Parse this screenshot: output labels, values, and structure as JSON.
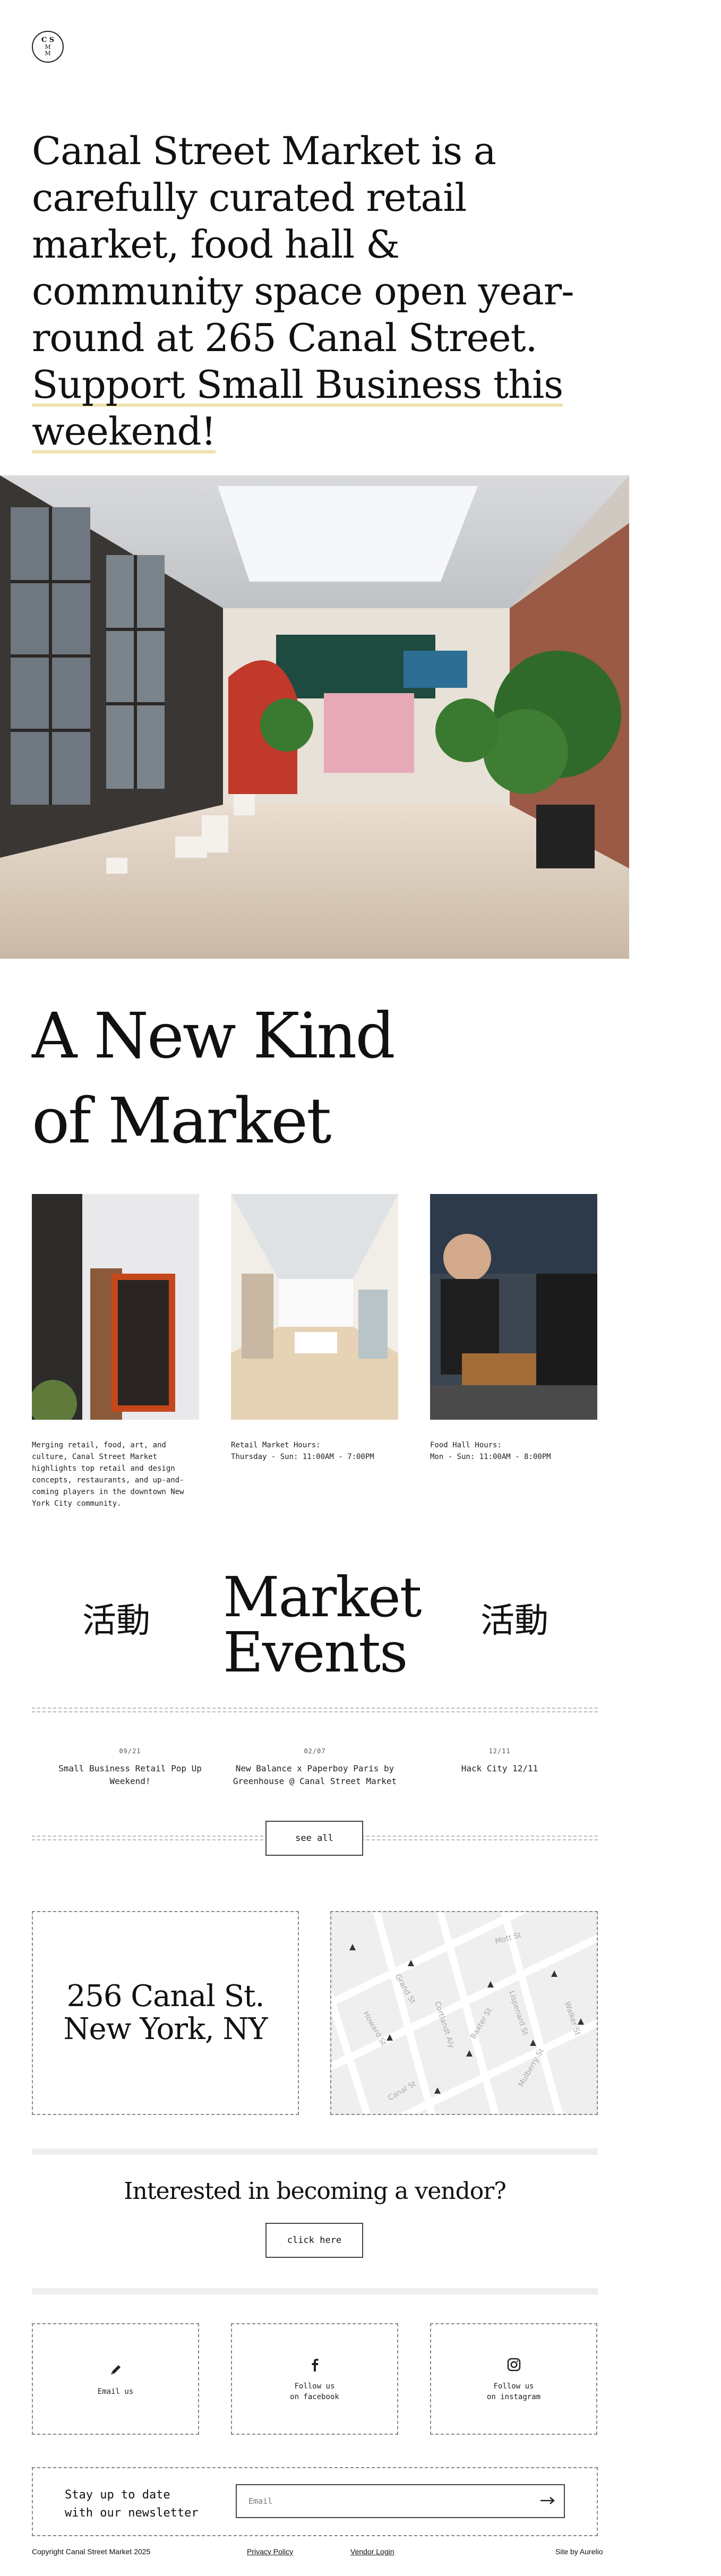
{
  "logo": {
    "line1": "C S",
    "line2": "M",
    "line3": "M"
  },
  "hero": {
    "text_main": "Canal Street Market is a carefully curated retail market, food hall & community space open year-round at 265 Canal Street. ",
    "text_highlight": "Support Small Business this weekend!"
  },
  "section_title_line1": "A New Kind",
  "section_title_line2": "of Market",
  "cards": [
    {
      "text": "Merging retail, food, art, and culture, Canal Street Market highlights top retail and design concepts, restaurants, and up-and-coming players in the downtown New York City community."
    },
    {
      "line1": "Retail Market Hours:",
      "line2": "Thursday - Sun: 11:00AM - 7:00PM"
    },
    {
      "line1": "Food Hall Hours:",
      "line2": "Mon - Sun: 11:00AM - 8:00PM"
    }
  ],
  "events": {
    "chinese_left": "活動",
    "chinese_right": "活動",
    "title_line1": "Market",
    "title_line2": "Events",
    "items": [
      {
        "date": "09/21",
        "name": "Small Business Retail Pop Up Weekend!"
      },
      {
        "date": "02/07",
        "name": "New Balance x Paperboy Paris by Greenhouse @ Canal Street Market"
      },
      {
        "date": "12/11",
        "name": "Hack City 12/11"
      }
    ],
    "see_all": "see all"
  },
  "address": {
    "line1": "256 Canal St.",
    "line2": "New York, NY"
  },
  "map": {
    "streets": [
      "Grand St",
      "Howard St",
      "Canal St",
      "Lispenard St",
      "Walker St",
      "Baxter St",
      "Mott St",
      "Cortlandt Aly",
      "Mulberry St"
    ]
  },
  "vendor": {
    "question": "Interested in becoming a vendor?",
    "button": "click here"
  },
  "social": [
    {
      "icon": "pencil-icon",
      "line1": "Email us",
      "line2": ""
    },
    {
      "icon": "facebook-icon",
      "line1": "Follow us",
      "line2": "on facebook"
    },
    {
      "icon": "instagram-icon",
      "line1": "Follow us",
      "line2": "on instagram"
    }
  ],
  "newsletter": {
    "label_line1": "Stay up to date",
    "label_line2": "with our newsletter",
    "placeholder": "Email"
  },
  "footer": {
    "copyright": "Copyright Canal Street Market 2025",
    "privacy": "Privacy Policy",
    "vendor_login": "Vendor Login",
    "site_by": "Site by Aurelio"
  },
  "colors": {
    "highlight": "#f0e3b2",
    "dash": "#888888",
    "bar": "#eeeeee"
  }
}
